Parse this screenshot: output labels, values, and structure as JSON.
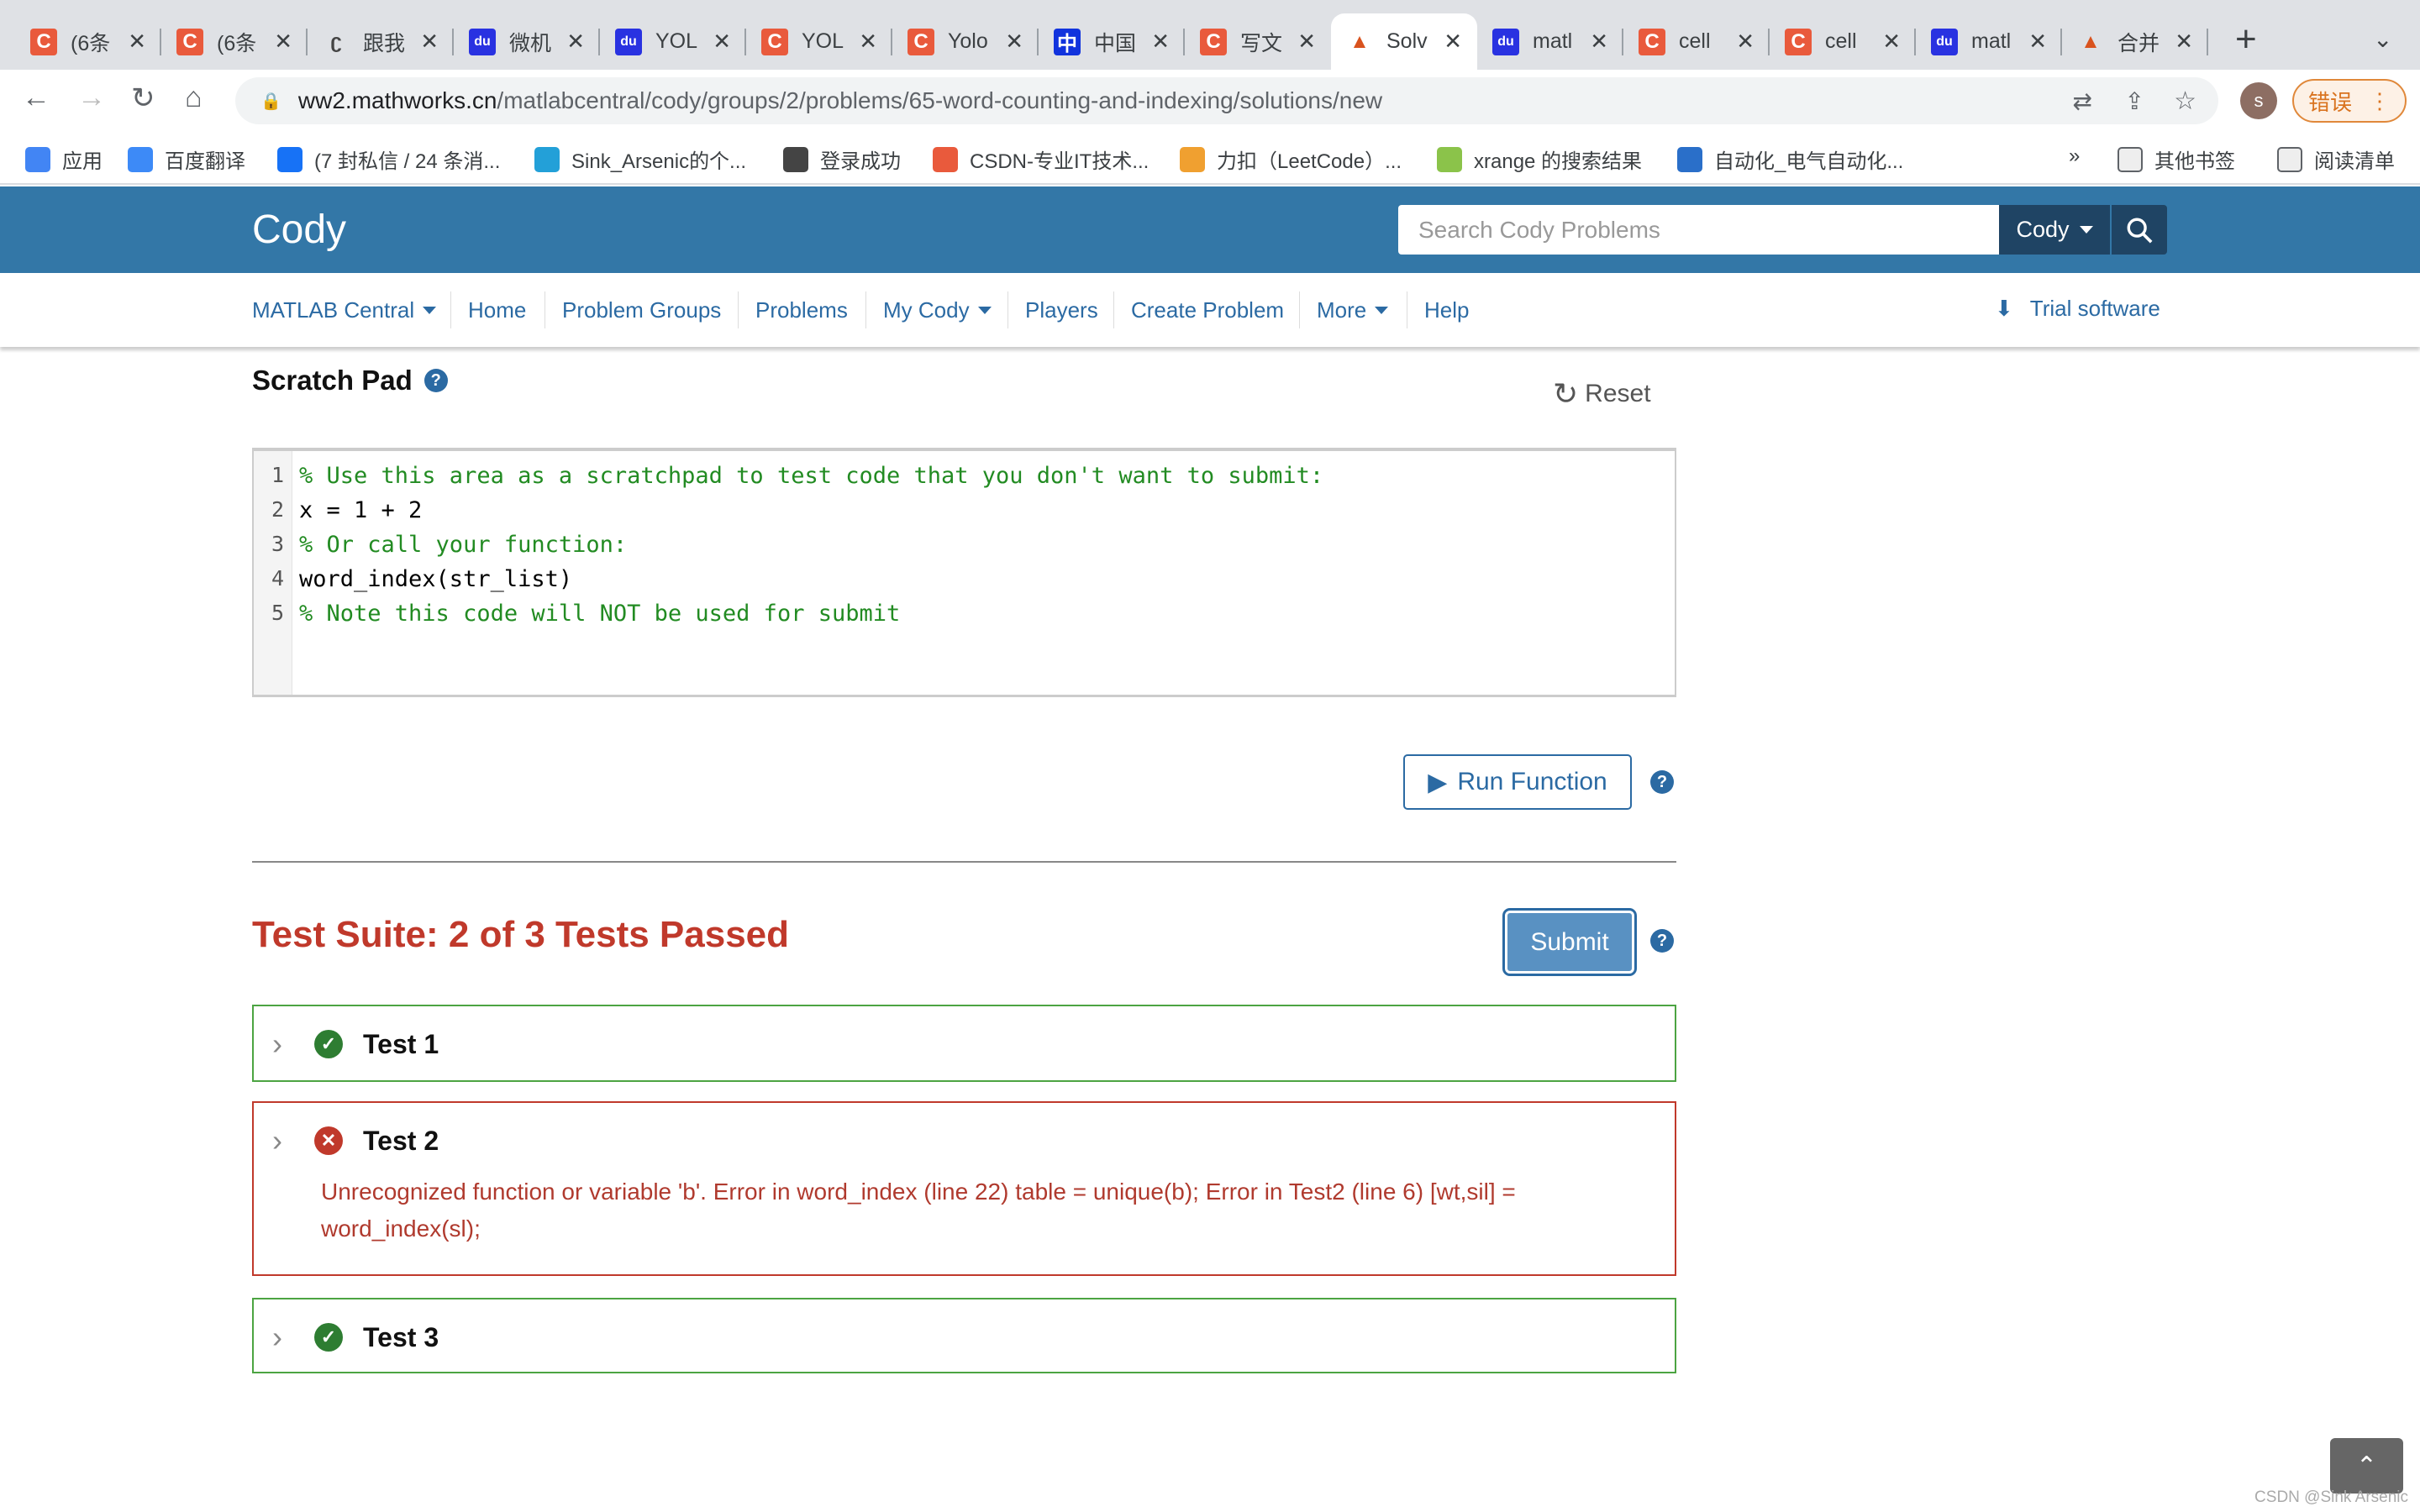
{
  "browser": {
    "tabs": [
      {
        "title": "(6条",
        "icon": "csdn-icon",
        "color": "#e95a3c",
        "active": false
      },
      {
        "title": "(6条",
        "icon": "csdn-icon",
        "color": "#e95a3c",
        "active": false
      },
      {
        "title": "跟我",
        "icon": "leetcode-icon",
        "color": "#444444",
        "active": false
      },
      {
        "title": "微机",
        "icon": "baidu-icon",
        "color": "#2932e1",
        "active": false
      },
      {
        "title": "YOL",
        "icon": "baidu-icon",
        "color": "#2932e1",
        "active": false
      },
      {
        "title": "YOL",
        "icon": "csdn-icon",
        "color": "#e95a3c",
        "active": false
      },
      {
        "title": "Yolo",
        "icon": "csdn-icon",
        "color": "#e95a3c",
        "active": false
      },
      {
        "title": "中国",
        "icon": "cnki-icon",
        "color": "#1133dd",
        "active": false
      },
      {
        "title": "写文",
        "icon": "csdn-icon",
        "color": "#e95a3c",
        "active": false
      },
      {
        "title": "Solv",
        "icon": "matlab-icon",
        "color": "#d9531e",
        "active": true
      },
      {
        "title": "matl",
        "icon": "baidu-icon",
        "color": "#2932e1",
        "active": false
      },
      {
        "title": "cell",
        "icon": "csdn-icon",
        "color": "#e95a3c",
        "active": false
      },
      {
        "title": "cell",
        "icon": "csdn-icon",
        "color": "#e95a3c",
        "active": false
      },
      {
        "title": "matl",
        "icon": "baidu-icon",
        "color": "#2932e1",
        "active": false
      },
      {
        "title": "合并",
        "icon": "matlab-icon",
        "color": "#d9531e",
        "active": false
      }
    ],
    "url_host": "ww2.mathworks.cn",
    "url_path": "/matlabcentral/cody/groups/2/problems/65-word-counting-and-indexing/solutions/new",
    "profile_initial": "s",
    "error_label": "错误",
    "bookmarks": [
      {
        "label": "应用",
        "icon": "apps-icon",
        "color": "#4285f4"
      },
      {
        "label": "百度翻译",
        "icon": "translate-icon",
        "color": "#3d8af7"
      },
      {
        "label": "(7 封私信 / 24 条消...",
        "icon": "zhihu-icon",
        "color": "#1772f6"
      },
      {
        "label": "Sink_Arsenic的个...",
        "icon": "bilibili-icon",
        "color": "#23a0d8"
      },
      {
        "label": "登录成功",
        "icon": "globe-icon",
        "color": "#444444"
      },
      {
        "label": "CSDN-专业IT技术...",
        "icon": "csdn-icon",
        "color": "#e95a3c"
      },
      {
        "label": "力扣（LeetCode）...",
        "icon": "leetcode-icon",
        "color": "#f0a030"
      },
      {
        "label": "xrange 的搜索结果",
        "icon": "code-icon",
        "color": "#8bc34a"
      },
      {
        "label": "自动化_电气自动化...",
        "icon": "bolt-icon",
        "color": "#2a6fc9"
      }
    ],
    "more_bookmarks": "»",
    "other_bookmarks": "其他书签",
    "reading_list": "阅读清单"
  },
  "header": {
    "logo": "Cody",
    "search_placeholder": "Search Cody Problems",
    "scope": "Cody"
  },
  "nav": {
    "items": [
      {
        "label": "MATLAB Central",
        "dropdown": true
      },
      {
        "label": "Home"
      },
      {
        "label": "Problem Groups"
      },
      {
        "label": "Problems"
      },
      {
        "label": "My Cody",
        "dropdown": true
      },
      {
        "label": "Players"
      },
      {
        "label": "Create Problem"
      },
      {
        "label": "More",
        "dropdown": true
      },
      {
        "label": "Help"
      }
    ],
    "trial": "Trial software"
  },
  "scratch": {
    "title": "Scratch Pad",
    "reset": "Reset",
    "lines": [
      {
        "n": "1",
        "text": "% Use this area as a scratchpad to test code that you don't want to submit:",
        "comment": true
      },
      {
        "n": "2",
        "text": "x = 1 + 2",
        "comment": false
      },
      {
        "n": "3",
        "text": "% Or call your function:",
        "comment": true
      },
      {
        "n": "4",
        "text": "word_index(str_list)",
        "comment": false
      },
      {
        "n": "5",
        "text": "% Note this code will NOT be used for submit",
        "comment": true
      }
    ],
    "run": "Run Function"
  },
  "suite": {
    "title": "Test Suite: 2 of 3 Tests Passed",
    "submit": "Submit",
    "tests": [
      {
        "name": "Test 1",
        "status": "pass",
        "message": ""
      },
      {
        "name": "Test 2",
        "status": "fail",
        "message": "Unrecognized function or variable 'b'. Error in word_index (line 22) table = unique(b); Error in Test2 (line 6) [wt,sil] = word_index(sl);"
      },
      {
        "name": "Test 3",
        "status": "pass",
        "message": ""
      }
    ]
  },
  "colors": {
    "header": "#3377a7",
    "link": "#2b6aa3",
    "pass": "#2e7d32",
    "fail": "#c0392b"
  },
  "watermark": "CSDN @Sink Arsenic"
}
